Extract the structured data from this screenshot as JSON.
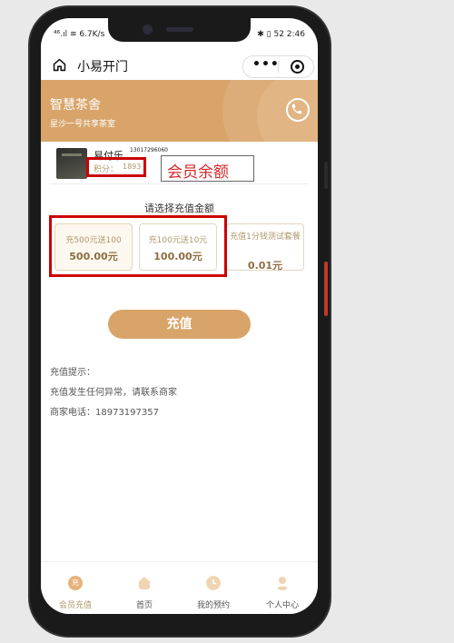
{
  "status_bar": {
    "left": "⁴⁶.ıl ≋ 6.7K/s",
    "right": "✱ ▯ 52 2:46"
  },
  "navbar": {
    "title": "小易开门",
    "menu_glyph": "•••"
  },
  "shop": {
    "name": "智慧茶舍",
    "address": "星沙一号共享茶室"
  },
  "user": {
    "name": "易付乐",
    "phone": "13017296060",
    "points_label": "积分：",
    "points_value": "1893",
    "annotation": "会员余额"
  },
  "recharge": {
    "title": "请选择充值金额",
    "options": [
      {
        "label": "充500元送100",
        "amount": "500.00元",
        "selected": true
      },
      {
        "label": "充100元送10元",
        "amount": "100.00元",
        "selected": false
      },
      {
        "label": "充值1分钱测试套餐",
        "amount": "0.01元",
        "selected": false
      }
    ],
    "button": "充值"
  },
  "tips": {
    "title": "充值提示：",
    "line1": "充值发生任何异常，请联系商家",
    "line2": "商家电话：18973197357"
  },
  "tabbar": {
    "active_icon_text": "充",
    "items": [
      {
        "label": "会员充值",
        "icon": "member-recharge-icon"
      },
      {
        "label": "首页",
        "icon": "home-icon"
      },
      {
        "label": "我的预约",
        "icon": "clock-icon"
      },
      {
        "label": "个人中心",
        "icon": "person-icon"
      }
    ]
  },
  "colors": {
    "accent": "#d8a469",
    "highlight": "#cc0000"
  }
}
